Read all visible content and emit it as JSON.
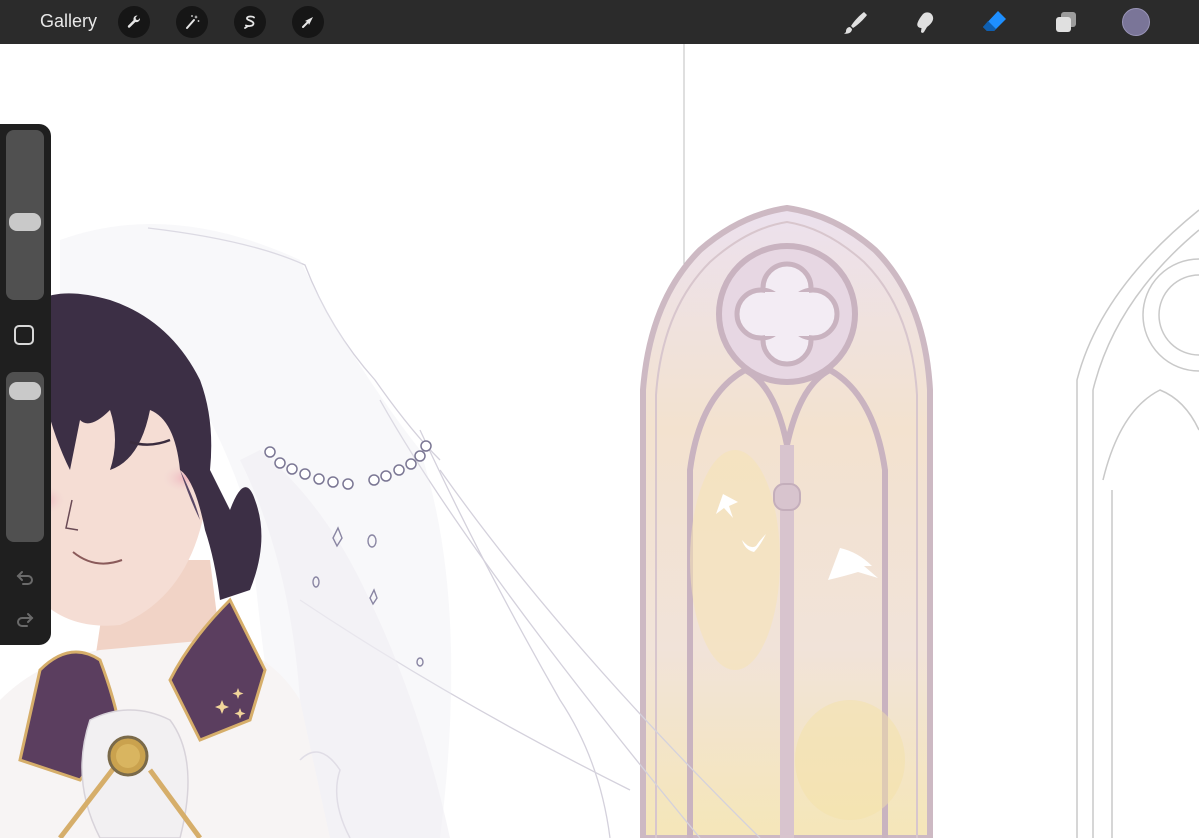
{
  "toolbar": {
    "gallery_label": "Gallery",
    "left_tools": [
      "wrench-icon",
      "magic-wand-icon",
      "selection-s-icon",
      "transform-arrow-icon"
    ],
    "right_tools": [
      "brush-icon",
      "smudge-icon",
      "eraser-icon",
      "layers-icon"
    ],
    "active_tool": "eraser-icon",
    "active_color": "#7a7598",
    "accent_color": "#1e8fff"
  },
  "sidebar": {
    "brush_size_level": 0.45,
    "opacity_level": 0.05,
    "modify_button": "square-icon",
    "undo_icon": "undo-icon",
    "redo_icon": "redo-icon"
  }
}
